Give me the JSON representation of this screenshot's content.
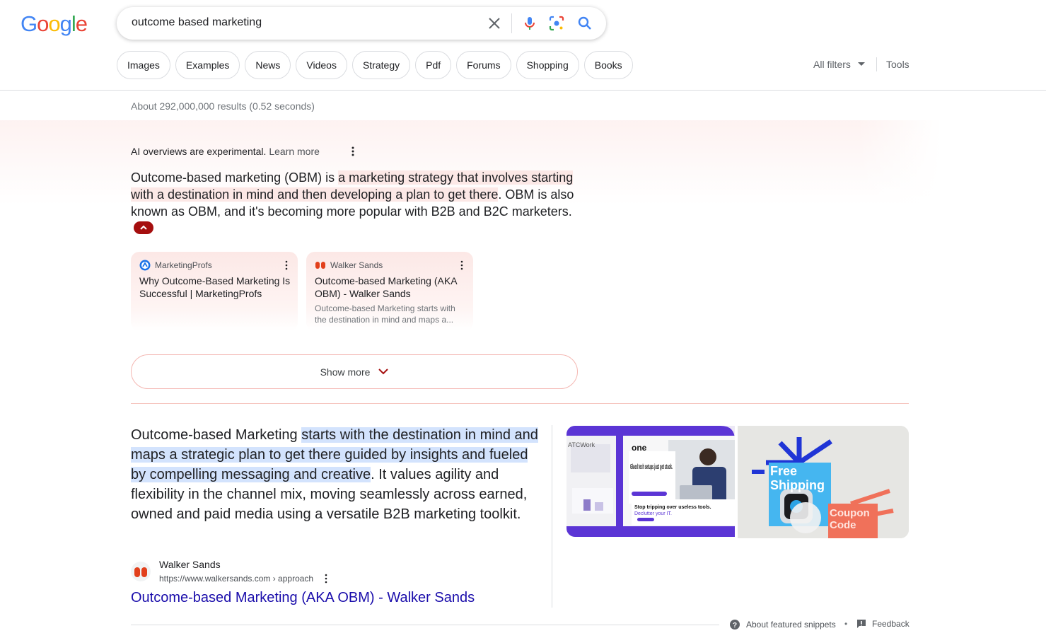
{
  "logo": {
    "letters": [
      "G",
      "o",
      "o",
      "g",
      "l",
      "e"
    ],
    "colors": [
      "#4285F4",
      "#EA4335",
      "#FBBC05",
      "#4285F4",
      "#34A853",
      "#EA4335"
    ]
  },
  "search": {
    "query": "outcome based marketing"
  },
  "chips": [
    "Images",
    "Examples",
    "News",
    "Videos",
    "Strategy",
    "Pdf",
    "Forums",
    "Shopping",
    "Books"
  ],
  "filters": {
    "all_filters": "All filters",
    "tools": "Tools"
  },
  "stats": "About 292,000,000 results (0.52 seconds)",
  "ai_overview": {
    "note": "AI overviews are experimental.",
    "learn_more": "Learn more",
    "text_pre": "Outcome-based marketing (OBM) is ",
    "text_highlight": "a marketing strategy that involves starting with a destination in mind and then developing a plan to get there",
    "text_post": ". OBM is also known as OBM, and it's becoming more popular with B2B and B2C marketers.",
    "sources": [
      {
        "site": "MarketingProfs",
        "title": "Why Outcome-Based Marketing Is Successful | MarketingProfs",
        "snippet": ""
      },
      {
        "site": "Walker Sands",
        "title": "Outcome-based Marketing (AKA OBM) - Walker Sands",
        "snippet": "Outcome-based Marketing starts with the destination in mind and maps a..."
      }
    ],
    "show_more": "Show more"
  },
  "featured_snippet": {
    "text_pre": "Outcome-based Marketing ",
    "text_highlight": "starts with the destination in mind and maps a strategic plan to get there guided by insights and fueled by compelling messaging and creative",
    "text_post": ". It values agility and flexibility in the channel mix, moving seamlessly across earned, owned and paid media using a versatile B2B marketing toolkit.",
    "source_name": "Walker Sands",
    "source_url": "https://www.walkersands.com › approach",
    "link_title": "Outcome-based Marketing (AKA OBM) - Walker Sands",
    "image1": {
      "tag": "one",
      "headline": "Glued tech setups just get stuck.",
      "sub": "Stop tripping over useless tools.",
      "sub2": "Declutter your IT.",
      "corner": "ATCWork"
    },
    "image2": {
      "line1": "Free",
      "line2": "Shipping",
      "line3": "Coupon",
      "line4": "Code"
    },
    "about_label": "About featured snippets",
    "bullet": "•",
    "feedback_label": "Feedback"
  },
  "colors": {
    "accent_pink": "#fce8e6",
    "highlight_blue": "#d3e3fd",
    "link": "#1a0dab",
    "collapse_red": "#a50e0e"
  }
}
